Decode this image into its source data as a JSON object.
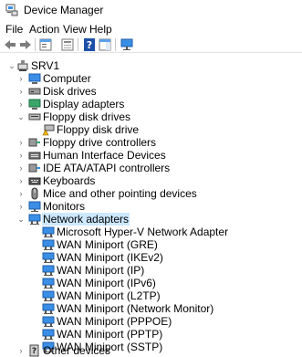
{
  "window": {
    "title": "Device Manager"
  },
  "menu": [
    "File",
    "Action",
    "View",
    "Help"
  ],
  "toolbar": {
    "buttons": [
      "back-arrow-icon",
      "forward-arrow-icon",
      "show-hide-tree-icon",
      "properties-icon",
      "help-icon",
      "action-pane-icon",
      "monitor-icon"
    ]
  },
  "tree": {
    "root": {
      "label": "SRV1",
      "icon": "computer-root-icon",
      "expanded": true
    },
    "categories": [
      {
        "label": "Computer",
        "icon": "computer-icon",
        "expanded": false
      },
      {
        "label": "Disk drives",
        "icon": "disk-drive-icon",
        "expanded": false
      },
      {
        "label": "Display adapters",
        "icon": "display-adapter-icon",
        "expanded": false
      },
      {
        "label": "Floppy disk drives",
        "icon": "floppy-disk-icon",
        "expanded": true,
        "children": [
          {
            "label": "Floppy disk drive",
            "icon": "floppy-disk-warning-icon"
          }
        ]
      },
      {
        "label": "Floppy drive controllers",
        "icon": "floppy-controller-icon",
        "expanded": false
      },
      {
        "label": "Human Interface Devices",
        "icon": "hid-icon",
        "expanded": false
      },
      {
        "label": "IDE ATA/ATAPI controllers",
        "icon": "ide-controller-icon",
        "expanded": false
      },
      {
        "label": "Keyboards",
        "icon": "keyboard-icon",
        "expanded": false
      },
      {
        "label": "Mice and other pointing devices",
        "icon": "mouse-icon",
        "expanded": false
      },
      {
        "label": "Monitors",
        "icon": "monitor-icon",
        "expanded": false
      },
      {
        "label": "Network adapters",
        "icon": "network-adapter-icon",
        "expanded": true,
        "selected": true,
        "children": [
          {
            "label": "Microsoft Hyper-V Network Adapter",
            "icon": "network-adapter-icon"
          },
          {
            "label": "WAN Miniport (GRE)",
            "icon": "network-adapter-icon"
          },
          {
            "label": "WAN Miniport (IKEv2)",
            "icon": "network-adapter-icon"
          },
          {
            "label": "WAN Miniport (IP)",
            "icon": "network-adapter-icon"
          },
          {
            "label": "WAN Miniport (IPv6)",
            "icon": "network-adapter-icon"
          },
          {
            "label": "WAN Miniport (L2TP)",
            "icon": "network-adapter-icon"
          },
          {
            "label": "WAN Miniport (Network Monitor)",
            "icon": "network-adapter-icon"
          },
          {
            "label": "WAN Miniport (PPPOE)",
            "icon": "network-adapter-icon"
          },
          {
            "label": "WAN Miniport (PPTP)",
            "icon": "network-adapter-icon"
          },
          {
            "label": "WAN Miniport (SSTP)",
            "icon": "network-adapter-icon"
          }
        ]
      },
      {
        "label": "Other devices",
        "icon": "other-devices-icon",
        "expanded": false
      }
    ]
  },
  "colors": {
    "selection": "#cce8ff",
    "network_icon": "#1f78d1",
    "warning": "#f5b400"
  }
}
